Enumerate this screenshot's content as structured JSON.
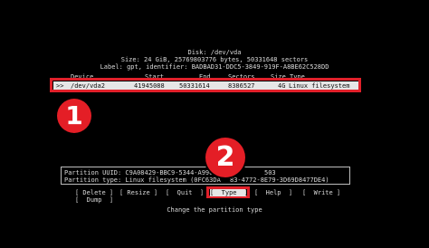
{
  "disk": {
    "title": "Disk: /dev/vda",
    "size_line": "Size: 24 GiB, 25769803776 bytes, 50331648 sectors",
    "label_line": "Label: gpt, identifier: BADBAD31-DDC5-3849-919F-A8BE62C528DD"
  },
  "table": {
    "headers": {
      "device": "Device",
      "start": "Start",
      "end": "End",
      "sectors": "Sectors",
      "size": "Size",
      "type": "Type"
    },
    "selected_row": {
      "marker": ">>",
      "device": "/dev/vda2",
      "start": "41945088",
      "end": "50331614",
      "sectors": "8386527",
      "size": "4G",
      "type": "Linux filesystem"
    }
  },
  "annotations": {
    "badge_1": "1",
    "badge_2": "2",
    "accent_color": "#e0202a"
  },
  "info": {
    "uuid_line": "Partition UUID: C9A08429-BBC9-5344-A996",
    "uuid_tail": "503",
    "type_line": "Partition type: Linux filesystem (0FC63DA",
    "type_tail": "83-4772-8E79-3D69D8477DE4)"
  },
  "menu": {
    "delete": "[ Delete ]",
    "resize": "[ Resize ]",
    "quit": "[  Quit  ]",
    "type": "[  Type  ]",
    "help": "[  Help  ]",
    "write": "[  Write ]",
    "dump": "[  Dump  ]"
  },
  "hint": "Change the partition type"
}
